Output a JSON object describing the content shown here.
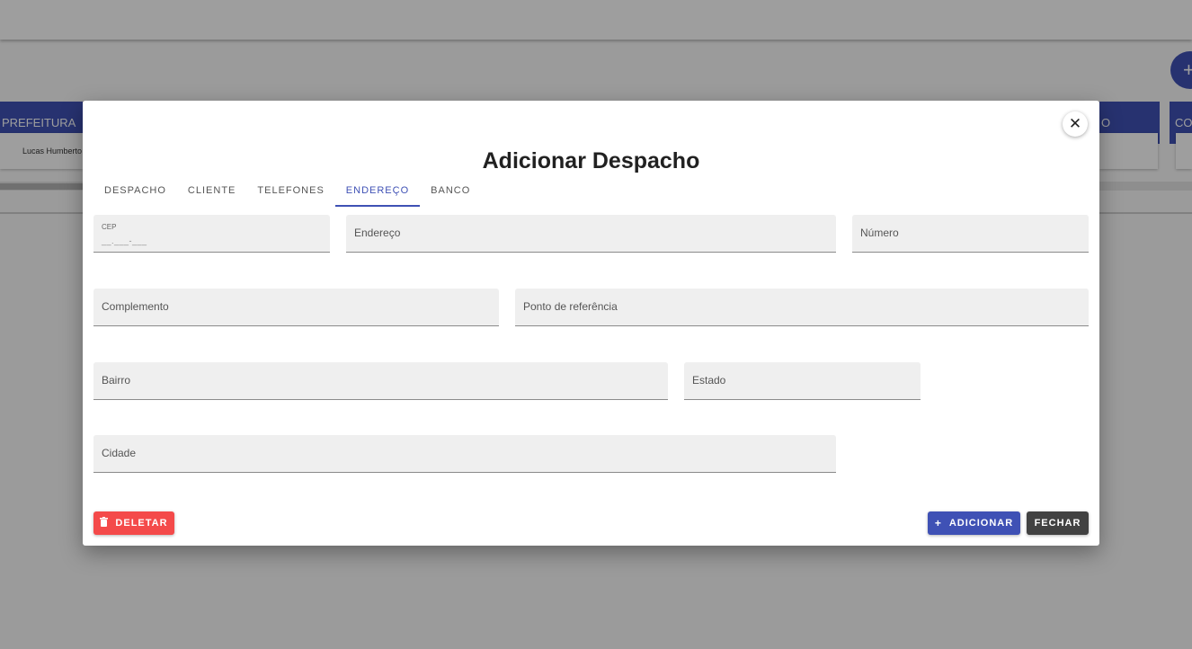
{
  "background": {
    "fab_icon": "plus-icon",
    "columns": [
      {
        "header": "PREFEITURA",
        "card": "Lucas Humberto"
      },
      {
        "header": "O",
        "card": ""
      },
      {
        "header": "CO",
        "card": ""
      }
    ]
  },
  "modal": {
    "title": "Adicionar Despacho",
    "close_icon": "close-icon",
    "tabs": [
      {
        "label": "DESPACHO",
        "active": false
      },
      {
        "label": "CLIENTE",
        "active": false
      },
      {
        "label": "TELEFONES",
        "active": false
      },
      {
        "label": "ENDEREÇO",
        "active": true
      },
      {
        "label": "BANCO",
        "active": false
      }
    ],
    "fields": {
      "cep": {
        "label": "CEP",
        "mask": "__.___-___"
      },
      "endereco": {
        "placeholder": "Endereço"
      },
      "numero": {
        "placeholder": "Número"
      },
      "complemento": {
        "placeholder": "Complemento"
      },
      "referencia": {
        "placeholder": "Ponto de referência"
      },
      "bairro": {
        "placeholder": "Bairro"
      },
      "estado": {
        "placeholder": "Estado"
      },
      "cidade": {
        "placeholder": "Cidade"
      }
    },
    "buttons": {
      "delete": "DELETAR",
      "add": "ADICIONAR",
      "close": "FECHAR"
    }
  },
  "colors": {
    "primary": "#3f51b5",
    "danger": "#f44a4a",
    "dark": "#424242"
  }
}
